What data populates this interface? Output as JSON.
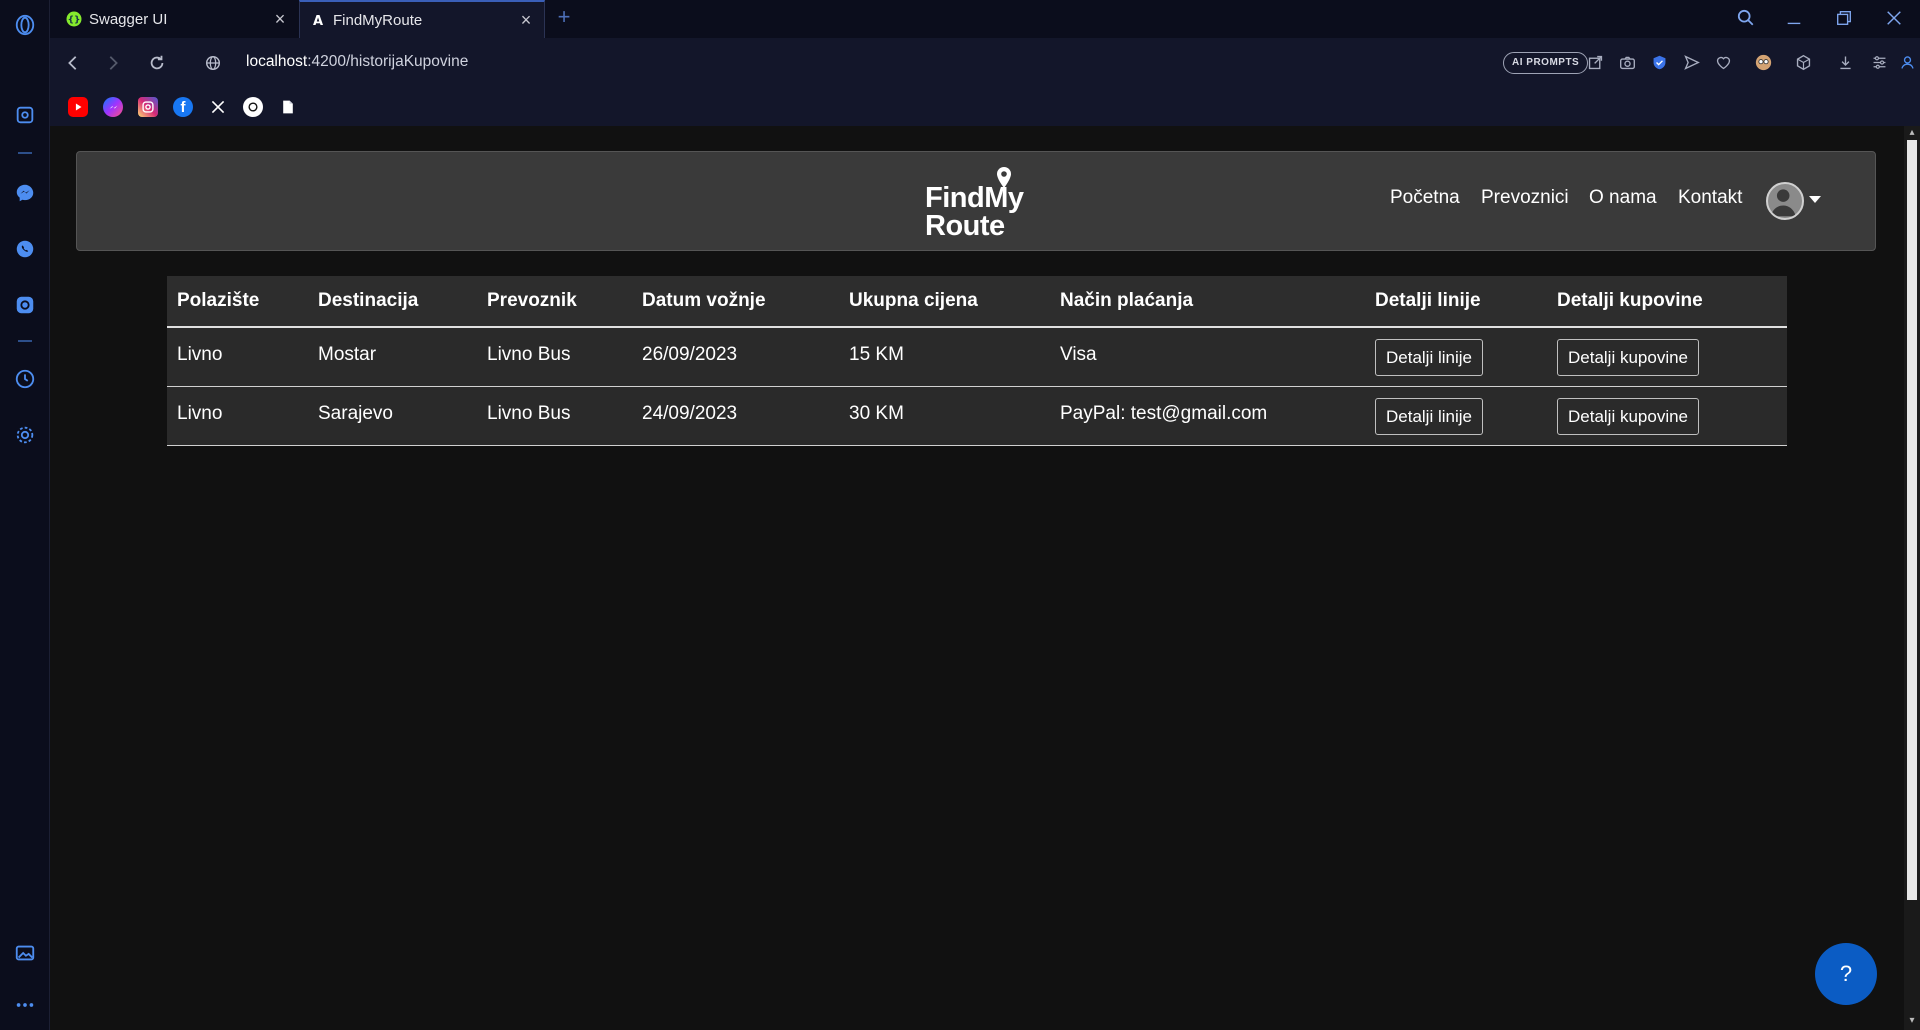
{
  "browser": {
    "tabs": [
      {
        "title": "Swagger UI",
        "icon": "swagger-icon"
      },
      {
        "title": "FindMyRoute",
        "icon": "angular-icon"
      }
    ],
    "new_tab": "+",
    "url_host": "localhost",
    "url_rest": ":4200/historijaKupovine",
    "ai_prompts": "AI PROMPTS"
  },
  "bookmarks": [
    "youtube",
    "messenger",
    "instagram",
    "facebook",
    "x",
    "chatgpt",
    "document"
  ],
  "site": {
    "logo_line1": "FindMy",
    "logo_line2": "Route",
    "nav": [
      "Početna",
      "Prevoznici",
      "O nama",
      "Kontakt"
    ]
  },
  "table": {
    "headers": [
      "Polazište",
      "Destinacija",
      "Prevoznik",
      "Datum vožnje",
      "Ukupna cijena",
      "Način plaćanja",
      "Detalji linije",
      "Detalji kupovine"
    ],
    "rows": [
      {
        "from": "Livno",
        "to": "Mostar",
        "carrier": "Livno Bus",
        "date": "26/09/2023",
        "price": "15 KM",
        "payment": "Visa",
        "btn_line": "Detalji linije",
        "btn_purchase": "Detalji kupovine"
      },
      {
        "from": "Livno",
        "to": "Sarajevo",
        "carrier": "Livno Bus",
        "date": "24/09/2023",
        "price": "30 KM",
        "payment": "PayPal: test@gmail.com",
        "btn_line": "Detalji linije",
        "btn_purchase": "Detalji kupovine"
      }
    ]
  },
  "help_label": "?",
  "colors": {
    "accent": "#0b5cc4",
    "navbar": "#3a3a3a",
    "page_bg": "#111111"
  }
}
